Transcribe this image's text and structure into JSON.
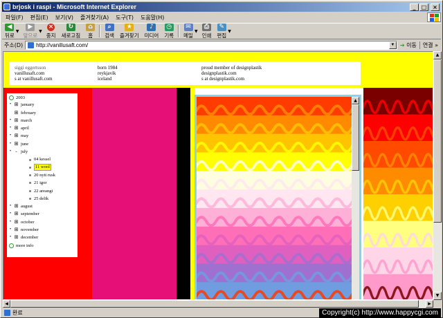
{
  "window": {
    "title": "brjosk i raspi - Microsoft Internet Explorer",
    "min_label": "_",
    "max_label": "□",
    "close_label": "×"
  },
  "menu": [
    "파일(F)",
    "편집(E)",
    "보기(V)",
    "즐겨찾기(A)",
    "도구(T)",
    "도움말(H)"
  ],
  "toolbar": {
    "back": "뒤로",
    "forward": "앞으로",
    "stop": "중지",
    "refresh": "새로고침",
    "home": "홈",
    "search": "검색",
    "favorites": "즐겨찾기",
    "media": "미디어",
    "history": "기록",
    "mail": "메일",
    "print": "인쇄",
    "edit": "편집"
  },
  "address": {
    "label": "주소(D)",
    "url": "http://vanillusaft.com/",
    "go": "이동",
    "links": "연결"
  },
  "page": {
    "col1": [
      "siggi eggertsson",
      "vanillusaft.com",
      "s at vanillusaft.com"
    ],
    "col2": [
      "born 1984",
      "reykjavik",
      "iceland"
    ],
    "col3": [
      "proud member of designplastik",
      "designplastik.com",
      "s at designplastik.com"
    ],
    "year": "2003",
    "months_before": [
      "january",
      "february",
      "march",
      "april",
      "may",
      "june"
    ],
    "open_month": "july",
    "july_items": [
      "04 kessel",
      "11 wool",
      "20 nytt rusk",
      "21 igor",
      "22 areangi",
      "25 delik"
    ],
    "selected_item": "11 wool",
    "months_after": [
      "august",
      "september",
      "october",
      "november",
      "december"
    ],
    "more_info": "more info"
  },
  "status": {
    "text": "완료"
  },
  "overlay": {
    "copyright": "Copyright(c) http://www.happycgi.com"
  },
  "colors": {
    "yellow": "#ffff00",
    "red": "#ff0000",
    "pink": "#e60f78",
    "frame": "#7fd6f0",
    "title_blue": "#0a246a"
  },
  "pattern_bands": [
    "#ff3b00",
    "#ff8a00",
    "#ffc400",
    "#ffff00",
    "#fffde0",
    "#ffe6f0",
    "#ffb0d6",
    "#ff6fb8",
    "#e060c0",
    "#a070d0",
    "#6f9de0"
  ],
  "right_bands": [
    "#7a0000",
    "#ff0000",
    "#ff4a00",
    "#ff8c00",
    "#ffd000",
    "#ffff80",
    "#ffd6e8",
    "#ff9acb"
  ]
}
